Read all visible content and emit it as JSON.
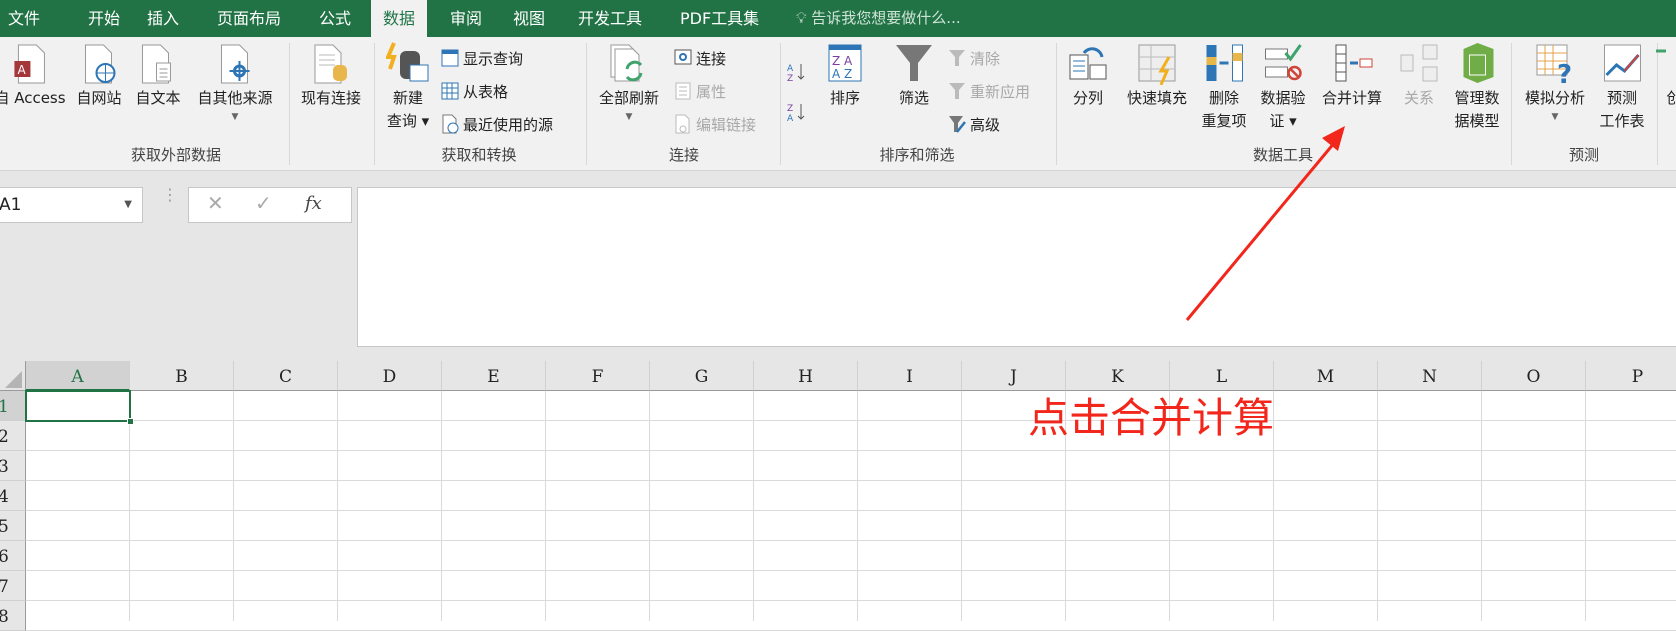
{
  "tabs": [
    "文件",
    "开始",
    "插入",
    "页面布局",
    "公式",
    "数据",
    "审阅",
    "视图",
    "开发工具",
    "PDF工具集"
  ],
  "active_tab": "数据",
  "tell_me": "告诉我您想要做什么...",
  "groups": [
    "获取外部数据",
    "获取和转换",
    "连接",
    "排序和筛选",
    "数据工具",
    "预测"
  ],
  "big_buttons": [
    {
      "lines": [
        "自 Access"
      ],
      "icon": "access-icon"
    },
    {
      "lines": [
        "自网站"
      ],
      "icon": "web-icon"
    },
    {
      "lines": [
        "自文本"
      ],
      "icon": "text-file-icon"
    },
    {
      "lines": [
        "自其他来源"
      ],
      "icon": "other-sources-icon",
      "dropdown": true
    },
    {
      "lines": [
        "现有连接"
      ],
      "icon": "existing-connections-icon"
    },
    {
      "lines": [
        "新建",
        "查询 ▾"
      ],
      "icon": "new-query-icon"
    },
    {
      "lines": [
        "全部刷新"
      ],
      "icon": "refresh-all-icon",
      "dropdown": true
    },
    {
      "lines": [
        "排序"
      ],
      "icon": "sort-icon"
    },
    {
      "lines": [
        "筛选"
      ],
      "icon": "filter-icon"
    },
    {
      "lines": [
        "分列"
      ],
      "icon": "text-to-columns-icon"
    },
    {
      "lines": [
        "快速填充"
      ],
      "icon": "flash-fill-icon"
    },
    {
      "lines": [
        "删除",
        "重复项"
      ],
      "icon": "remove-duplicates-icon"
    },
    {
      "lines": [
        "数据验",
        "证 ▾"
      ],
      "icon": "data-validation-icon"
    },
    {
      "lines": [
        "合并计算"
      ],
      "icon": "consolidate-icon"
    },
    {
      "lines": [
        "关系"
      ],
      "icon": "relationships-icon",
      "disabled": true
    },
    {
      "lines": [
        "管理数",
        "据模型"
      ],
      "icon": "data-model-icon"
    },
    {
      "lines": [
        "模拟分析"
      ],
      "icon": "what-if-icon",
      "dropdown": true
    },
    {
      "lines": [
        "预测",
        "工作表"
      ],
      "icon": "forecast-sheet-icon"
    },
    {
      "lines": [
        "创"
      ],
      "icon": "group-icon"
    }
  ],
  "small_buttons": [
    {
      "label": "显示查询",
      "icon": "show-queries-icon"
    },
    {
      "label": "从表格",
      "icon": "from-table-icon"
    },
    {
      "label": "最近使用的源",
      "icon": "recent-sources-icon"
    },
    {
      "label": "连接",
      "icon": "connections-icon"
    },
    {
      "label": "属性",
      "icon": "properties-icon",
      "disabled": true
    },
    {
      "label": "编辑链接",
      "icon": "edit-links-icon",
      "disabled": true
    },
    {
      "label": "",
      "icon": "sort-a-z-icon"
    },
    {
      "label": "",
      "icon": "sort-z-a-icon"
    },
    {
      "label": "清除",
      "icon": "clear-filter-icon",
      "disabled": true
    },
    {
      "label": "重新应用",
      "icon": "reapply-icon",
      "disabled": true
    },
    {
      "label": "高级",
      "icon": "advanced-filter-icon"
    }
  ],
  "formula_bar": {
    "name_box": "A1",
    "cancel": "✕",
    "enter": "✓",
    "fx": "fx",
    "value": ""
  },
  "columns": [
    "A",
    "B",
    "C",
    "D",
    "E",
    "F",
    "G",
    "H",
    "I",
    "J",
    "K",
    "L",
    "M",
    "N",
    "O",
    "P"
  ],
  "rows": [
    "1",
    "2",
    "3",
    "4",
    "5",
    "6",
    "7",
    "8"
  ],
  "selected_cell": "A1",
  "annotation": {
    "text": "点击合并计算",
    "color": "#f2261a"
  },
  "colors": {
    "brand": "#217346"
  }
}
